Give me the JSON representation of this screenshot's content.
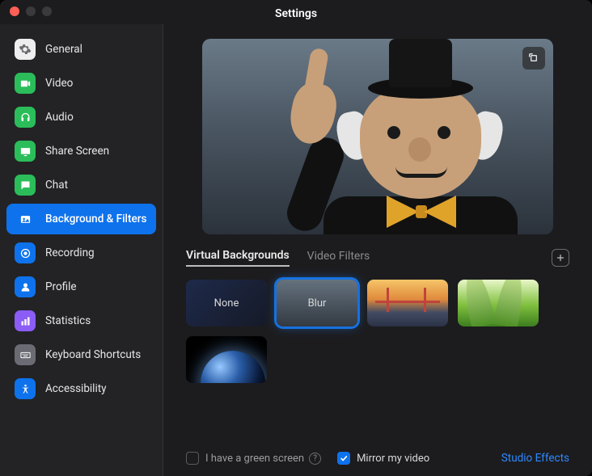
{
  "window": {
    "title": "Settings"
  },
  "sidebar": {
    "items": [
      {
        "label": "General",
        "icon": "gear-icon",
        "bg": "#eeeeee",
        "fg": "#6b6b6f"
      },
      {
        "label": "Video",
        "icon": "video-icon",
        "bg": "#2bbd5a",
        "fg": "#ffffff"
      },
      {
        "label": "Audio",
        "icon": "headphones-icon",
        "bg": "#2bbd5a",
        "fg": "#ffffff"
      },
      {
        "label": "Share Screen",
        "icon": "share-screen-icon",
        "bg": "#2bbd5a",
        "fg": "#ffffff"
      },
      {
        "label": "Chat",
        "icon": "chat-icon",
        "bg": "#2bbd5a",
        "fg": "#ffffff"
      },
      {
        "label": "Background & Filters",
        "icon": "background-icon",
        "bg": "#0e72ec",
        "fg": "#ffffff"
      },
      {
        "label": "Recording",
        "icon": "record-icon",
        "bg": "#0e72ec",
        "fg": "#ffffff"
      },
      {
        "label": "Profile",
        "icon": "person-icon",
        "bg": "#0e72ec",
        "fg": "#ffffff"
      },
      {
        "label": "Statistics",
        "icon": "stats-icon",
        "bg": "#8b5cf6",
        "fg": "#ffffff"
      },
      {
        "label": "Keyboard Shortcuts",
        "icon": "keyboard-icon",
        "bg": "#6b6b73",
        "fg": "#ffffff"
      },
      {
        "label": "Accessibility",
        "icon": "accessibility-icon",
        "bg": "#0e72ec",
        "fg": "#ffffff"
      }
    ],
    "activeIndex": 5
  },
  "tabs": {
    "virtual_backgrounds": "Virtual Backgrounds",
    "video_filters": "Video Filters",
    "active": "virtual_backgrounds"
  },
  "thumbnails": {
    "none": "None",
    "blur": "Blur",
    "selected": "blur"
  },
  "footer": {
    "green_screen_label": "I have a green screen",
    "green_screen_checked": false,
    "mirror_label": "Mirror my video",
    "mirror_checked": true,
    "studio_effects": "Studio Effects"
  }
}
